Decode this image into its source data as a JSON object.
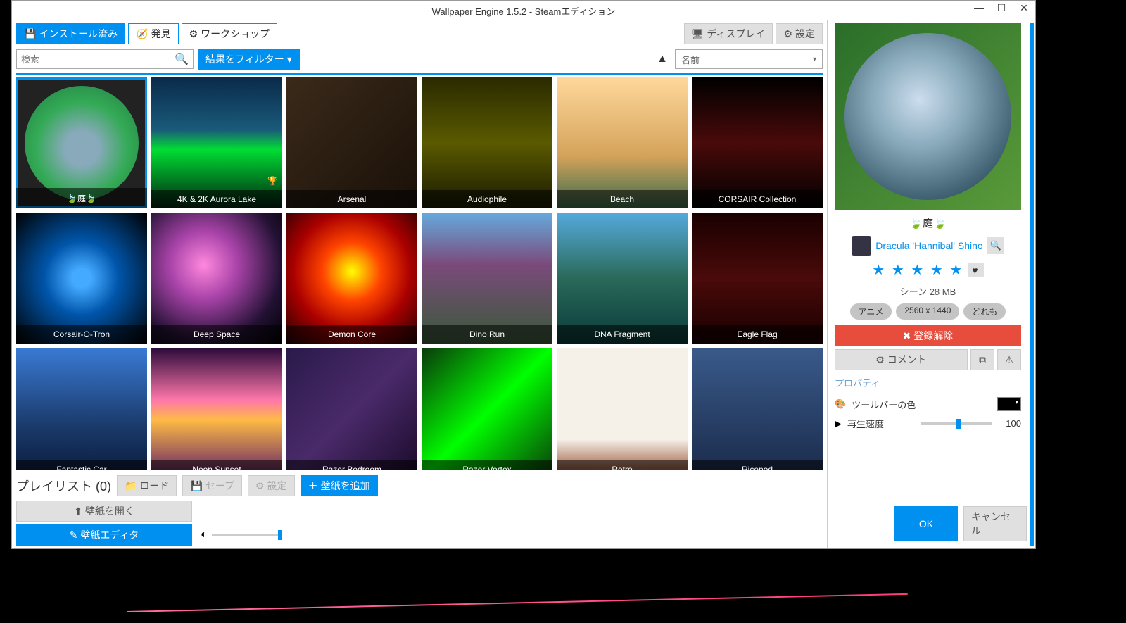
{
  "window": {
    "title": "Wallpaper Engine 1.5.2 - Steamエディション"
  },
  "tabs": {
    "installed": "インストール済み",
    "discover": "発見",
    "workshop": "ワークショップ",
    "display": "ディスプレイ",
    "settings": "設定"
  },
  "search": {
    "placeholder": "検索"
  },
  "filter_button": "結果をフィルター",
  "sort": {
    "label": "名前"
  },
  "tiles": [
    {
      "label": "🍃庭🍃",
      "selected": true
    },
    {
      "label": "4K & 2K Aurora Lake",
      "trophy": true
    },
    {
      "label": "Arsenal"
    },
    {
      "label": "Audiophile"
    },
    {
      "label": "Beach"
    },
    {
      "label": "CORSAIR Collection"
    },
    {
      "label": "Corsair-O-Tron"
    },
    {
      "label": "Deep Space"
    },
    {
      "label": "Demon Core"
    },
    {
      "label": "Dino Run"
    },
    {
      "label": "DNA Fragment"
    },
    {
      "label": "Eagle Flag"
    },
    {
      "label": "Fantastic Car"
    },
    {
      "label": "Neon Sunset"
    },
    {
      "label": "Razer Bedroom"
    },
    {
      "label": "Razer Vortex"
    },
    {
      "label": "Retro"
    },
    {
      "label": "Ricepod"
    }
  ],
  "playlist": {
    "title": "プレイリスト (0)",
    "load": "ロード",
    "save": "セーブ",
    "settings": "設定",
    "add": "壁紙を追加",
    "open": "壁紙を開く",
    "editor": "壁紙エディタ"
  },
  "sidebar": {
    "title": "🍃庭🍃",
    "author": "Dracula 'Hannibal' Shino",
    "stars": "★ ★ ★ ★ ★",
    "meta_type": "シーン",
    "meta_size": "28 MB",
    "tags": [
      "アニメ",
      "2560 x 1440",
      "どれも"
    ],
    "unsubscribe": "登録解除",
    "comment": "コメント",
    "properties_header": "プロパティ",
    "prop_toolbar_color": "ツールバーの色",
    "prop_speed": "再生速度",
    "speed_value": "100"
  },
  "footer": {
    "ok": "OK",
    "cancel": "キャンセル"
  }
}
